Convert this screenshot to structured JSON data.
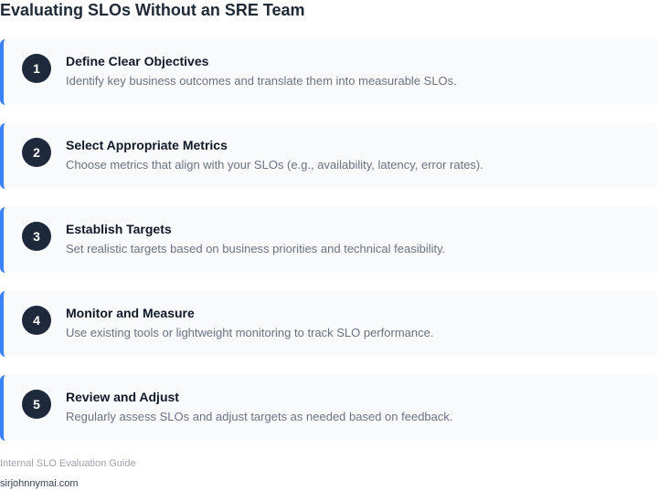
{
  "page": {
    "title": "Evaluating SLOs Without an SRE Team"
  },
  "steps": [
    {
      "number": "1",
      "title": "Define Clear Objectives",
      "description": "Identify key business outcomes and translate them into measurable SLOs."
    },
    {
      "number": "2",
      "title": "Select Appropriate Metrics",
      "description": "Choose metrics that align with your SLOs (e.g., availability, latency, error rates)."
    },
    {
      "number": "3",
      "title": "Establish Targets",
      "description": "Set realistic targets based on business priorities and technical feasibility."
    },
    {
      "number": "4",
      "title": "Monitor and Measure",
      "description": "Use existing tools or lightweight monitoring to track SLO performance."
    },
    {
      "number": "5",
      "title": "Review and Adjust",
      "description": "Regularly assess SLOs and adjust targets as needed based on feedback."
    }
  ],
  "footer": {
    "note": "Internal SLO Evaluation Guide",
    "site": "sirjohnnymai.com"
  },
  "colors": {
    "accent": "#3b82f6",
    "badge": "#1e293b",
    "card_background": "#f8fafc"
  }
}
